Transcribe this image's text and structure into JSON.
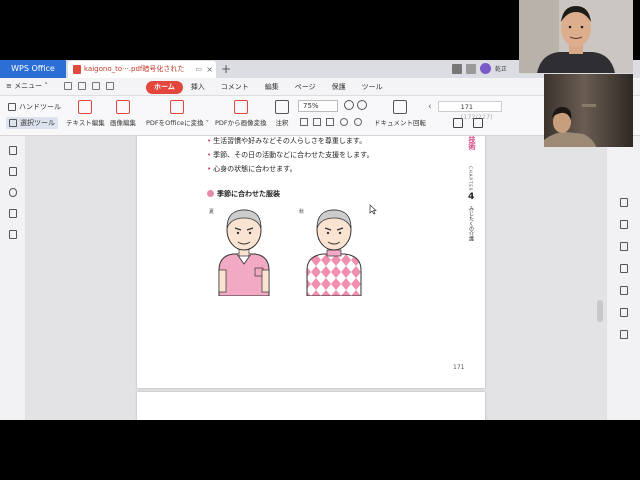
{
  "titlebar": {
    "app_name": "WPS Office",
    "doc_tab": "kaigono_to···.pdf暗号化された",
    "new_tab": "+",
    "user_name": "乾正"
  },
  "menubar": {
    "menu_label": "≡ メニュー ˅",
    "items": [
      "ホーム",
      "挿入",
      "コメント",
      "編集",
      "ページ",
      "保護",
      "ツール"
    ],
    "active": "ホーム"
  },
  "ribbon": {
    "hand_tool": "ハンドツール",
    "select_tool": "選択ツール",
    "text_edit": "テキスト編集",
    "image_edit": "画像編集",
    "pdf_to_office": "PDFをOfficeに変換 ˅",
    "pdf_to_image": "PDFから画像変換",
    "annotate": "注釈",
    "rotate": "ドキュメント回転",
    "zoom": "75%",
    "page_current": "171",
    "page_total": "(172/227)"
  },
  "document": {
    "bullets": [
      "生活習慣や好みなどその人らしさを尊重します。",
      "季節、その日の活動などに合わせた支援をします。",
      "心身の状態に合わせます。"
    ],
    "section_title": "季節に合わせた服装",
    "season_summer": "夏",
    "season_autumn": "秋",
    "page_number": "171",
    "chapter_title_pink": "技術",
    "chapter_label": "CHAPTER",
    "chapter_number": "4",
    "chapter_title": "みじたくの介護"
  },
  "colors": {
    "accent_red": "#e2463c",
    "app_blue": "#2b6fd6",
    "pink": "#e88aab",
    "chapter_pink": "#d6437d"
  }
}
